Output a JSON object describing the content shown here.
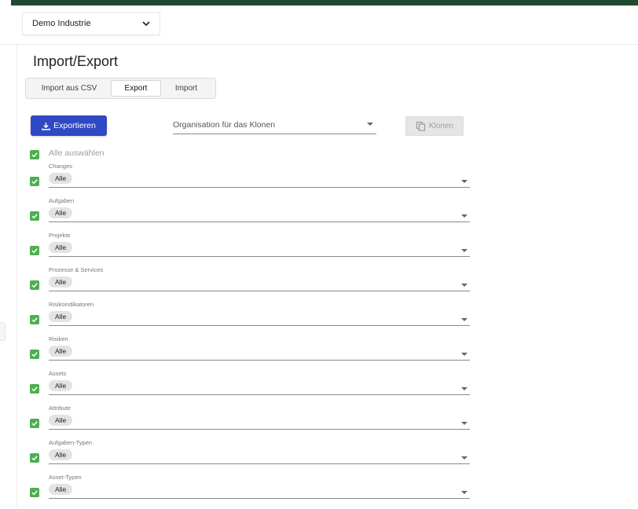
{
  "header": {
    "organization": "Demo Industrie"
  },
  "page": {
    "title": "Import/Export"
  },
  "tabs": [
    {
      "label": "Import aus CSV"
    },
    {
      "label": "Export"
    },
    {
      "label": "Import"
    }
  ],
  "toolbar": {
    "export_label": "Exportieren",
    "clone_placeholder": "Organisation für das Klonen",
    "clone_label": "Klonen"
  },
  "select_all_label": "Alle auswählen",
  "rows": [
    {
      "label": "Changes",
      "value": "Alle"
    },
    {
      "label": "Aufgaben",
      "value": "Alle"
    },
    {
      "label": "Projekte",
      "value": "Alle"
    },
    {
      "label": "Prozesse & Services",
      "value": "Alle"
    },
    {
      "label": "Risikoindikatoren",
      "value": "Alle"
    },
    {
      "label": "Risiken",
      "value": "Alle"
    },
    {
      "label": "Assets",
      "value": "Alle"
    },
    {
      "label": "Attribute",
      "value": "Alle"
    },
    {
      "label": "Aufgaben-Typen",
      "value": "Alle"
    },
    {
      "label": "Asset-Typen",
      "value": "Alle"
    }
  ],
  "colors": {
    "accent": "#2f48c3",
    "check": "#4caf50",
    "topbar": "#1f4a2e"
  }
}
